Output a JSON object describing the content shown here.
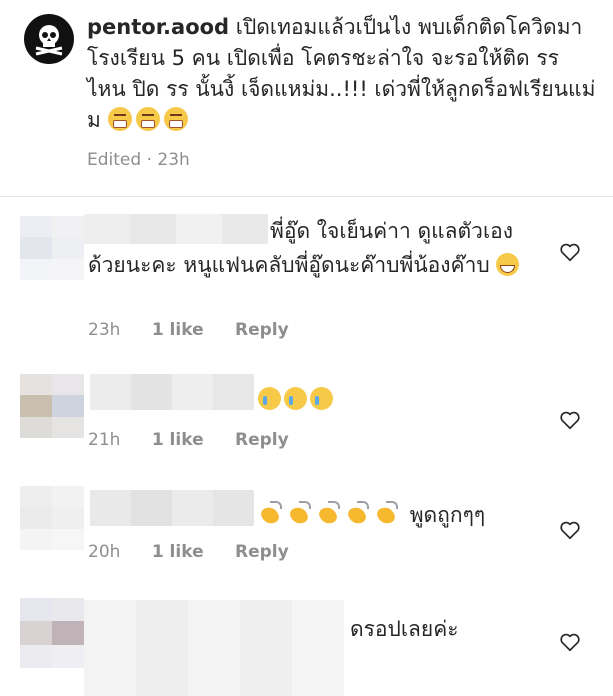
{
  "post": {
    "username": "pentor.aood",
    "text": "เปิดเทอมแล้วเป็นไง พบเด็กติดโควิดมา โรงเรียน 5 คน เปิดเพื่อ โคตรชะล่าใจ จะรอให้ติด รร ไหน ปิด รร นั้นงิ้ เจ็ดแหม่ม..!!! เด่วพี่ให้ลูกดร็อฟเรียนแม่ม",
    "emoji_count": 3,
    "edited_label": "Edited",
    "time": "23h"
  },
  "comments": [
    {
      "text": "พี่อู๊ด ใจเย็นค่าา ดูแลตัวเอง ด้วยนะคะ หนูแฟนคลับพี่อู๊ดนะค๊าบพี่น้องค๊าบ",
      "time": "23h",
      "likes": "1 like",
      "reply": "Reply"
    },
    {
      "text": "",
      "time": "21h",
      "likes": "1 like",
      "reply": "Reply"
    },
    {
      "text": "พูดถูกๆๆ",
      "time": "20h",
      "likes": "1 like",
      "reply": "Reply"
    },
    {
      "text": "ดรอปเลยค่ะ"
    }
  ],
  "icons": {
    "avatar": "skull-crossbones-icon",
    "like": "heart-outline-icon"
  },
  "colors": {
    "meta": "#8e8e8e",
    "text": "#262626",
    "divider": "#e6e6e6",
    "emoji": "#f7c948"
  }
}
